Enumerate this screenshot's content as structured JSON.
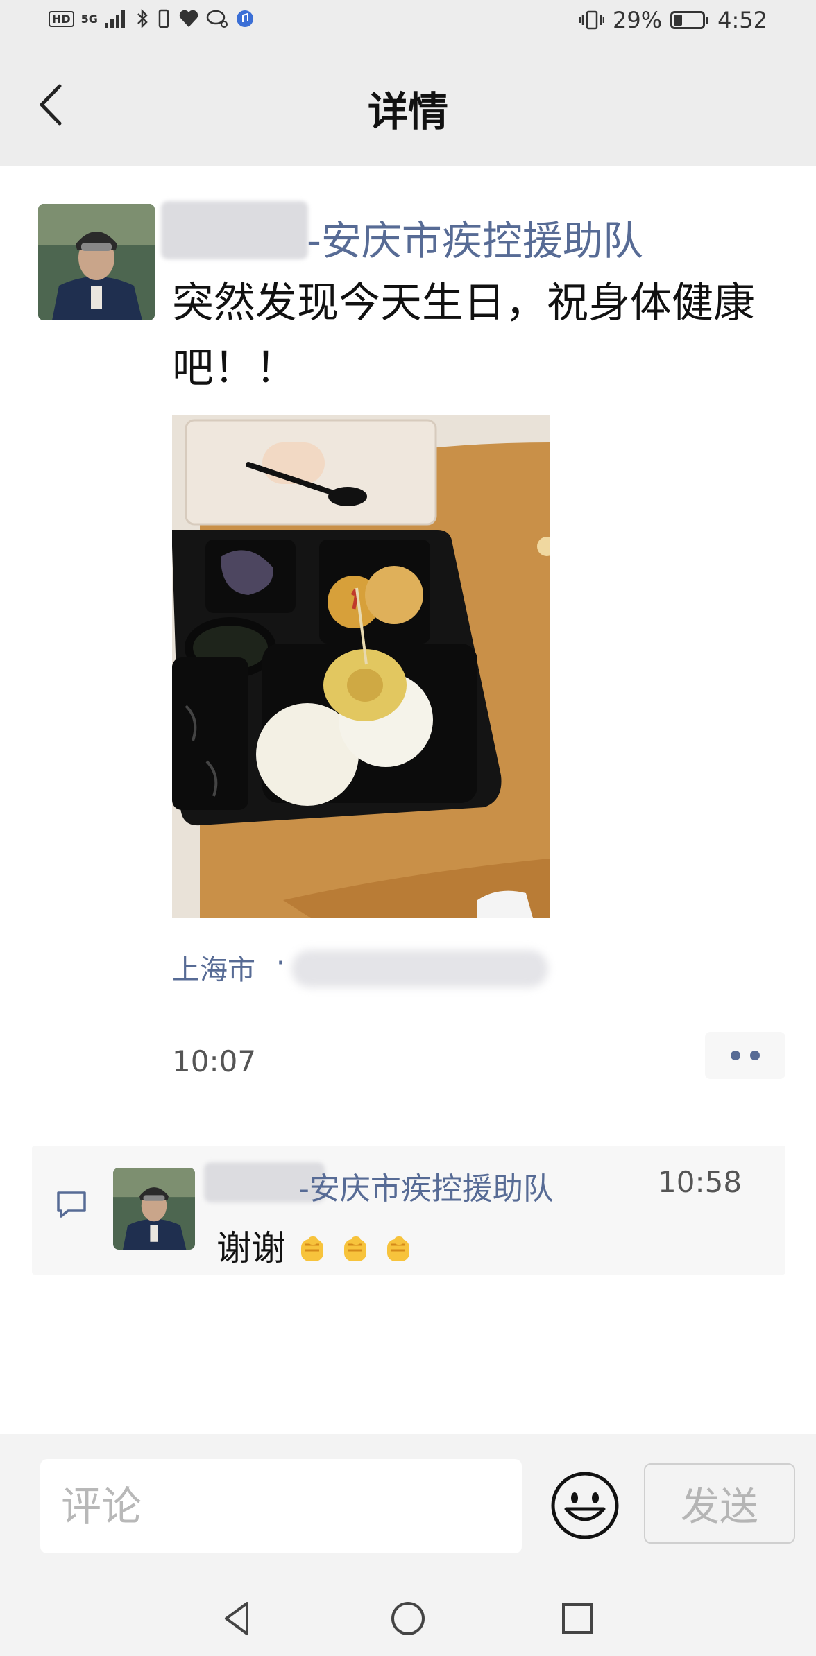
{
  "status_bar": {
    "hd": "HD",
    "network": "5G",
    "battery_percent": "29%",
    "battery_level": 0.29,
    "time": "4:52"
  },
  "header": {
    "title": "详情",
    "back_icon": "chevron-left-icon"
  },
  "post": {
    "author_suffix": "-安庆市疾控援助队",
    "text": "突然发现今天生日，祝身体健康吧！！",
    "location": "上海市",
    "location_separator": "·",
    "time": "10:07",
    "more_icon": "more-dots-icon"
  },
  "comment": {
    "author_suffix": "-安庆市疾控援助队",
    "time": "10:58",
    "text": "谢谢",
    "emoji_icons": [
      "raised-fist-icon",
      "raised-fist-icon",
      "raised-fist-icon"
    ]
  },
  "input": {
    "placeholder": "评论",
    "value": "",
    "emoji_icon": "smiley-icon",
    "send_label": "发送"
  },
  "nav": {
    "icons": [
      "nav-back-icon",
      "nav-home-icon",
      "nav-recents-icon"
    ]
  },
  "colors": {
    "link": "#576b95",
    "header_bg": "#ededed",
    "input_bg": "#f3f3f3"
  }
}
